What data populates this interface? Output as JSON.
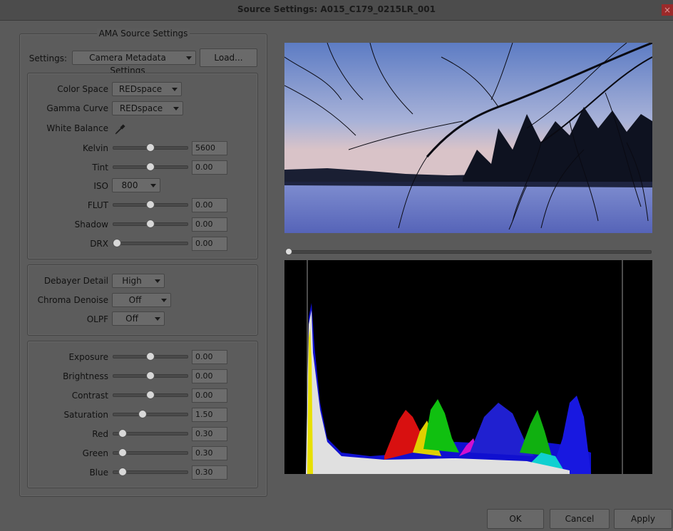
{
  "window": {
    "title": "Source Settings: A015_C179_0215LR_001",
    "close": "×"
  },
  "ama": {
    "legend": "AMA Source Settings",
    "settings_label": "Settings:",
    "settings_value": "Camera Metadata Settings",
    "load_label": "Load..."
  },
  "color_group": {
    "color_space": {
      "label": "Color Space",
      "value": "REDspace"
    },
    "gamma_curve": {
      "label": "Gamma Curve",
      "value": "REDspace"
    },
    "white_balance_label": "White Balance",
    "sliders": [
      {
        "label": "Kelvin",
        "value": "5600",
        "level": 0.5
      },
      {
        "label": "Tint",
        "value": "0.00",
        "level": 0.5
      },
      {
        "label": "FLUT",
        "value": "0.00",
        "level": 0.5
      },
      {
        "label": "Shadow",
        "value": "0.00",
        "level": 0.5
      },
      {
        "label": "DRX",
        "value": "0.00",
        "level": 0.0
      }
    ],
    "iso": {
      "label": "ISO",
      "value": "800"
    }
  },
  "debayer_group": {
    "debayer_detail": {
      "label": "Debayer Detail",
      "value": "High"
    },
    "chroma_denoise": {
      "label": "Chroma Denoise",
      "value": "Off"
    },
    "olpf": {
      "label": "OLPF",
      "value": "Off"
    }
  },
  "image_group": {
    "sliders": [
      {
        "label": "Exposure",
        "value": "0.00",
        "level": 0.5
      },
      {
        "label": "Brightness",
        "value": "0.00",
        "level": 0.5
      },
      {
        "label": "Contrast",
        "value": "0.00",
        "level": 0.5
      },
      {
        "label": "Saturation",
        "value": "1.50",
        "level": 0.38
      },
      {
        "label": "Red",
        "value": "0.30",
        "level": 0.08
      },
      {
        "label": "Green",
        "value": "0.30",
        "level": 0.08
      },
      {
        "label": "Blue",
        "value": "0.30",
        "level": 0.08
      }
    ]
  },
  "timeline": {
    "position": 0.0
  },
  "buttons": {
    "ok": "OK",
    "cancel": "Cancel",
    "apply": "Apply"
  },
  "icons": {
    "white_balance": "eyedropper-icon"
  }
}
